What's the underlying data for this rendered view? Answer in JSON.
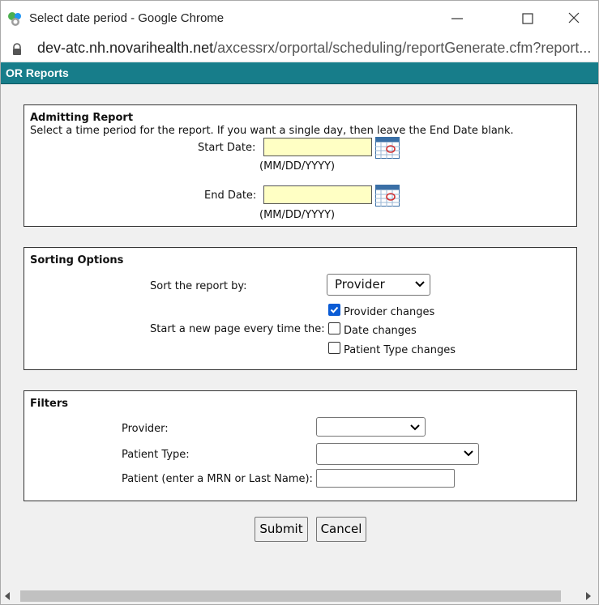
{
  "window": {
    "title": "Select date period - Google Chrome"
  },
  "browser": {
    "url_host": "dev-atc.nh.novarihealth.net",
    "url_path": "/axcessrx/orportal/scheduling/reportGenerate.cfm?report..."
  },
  "header": {
    "title": "OR Reports"
  },
  "admitting": {
    "title": "Admitting Report",
    "instructions": "Select a time period for the report. If you want a single day, then leave the End Date blank.",
    "start_label": "Start Date:",
    "start_value": "",
    "end_label": "End Date:",
    "end_value": "",
    "format_hint": "(MM/DD/YYYY)"
  },
  "sorting": {
    "title": "Sorting Options",
    "sort_label": "Sort the report by:",
    "sort_value": "Provider",
    "newpage_label": "Start a new page every time the:",
    "options": [
      {
        "label": "Provider changes",
        "checked": true
      },
      {
        "label": "Date changes",
        "checked": false
      },
      {
        "label": "Patient Type changes",
        "checked": false
      }
    ]
  },
  "filters": {
    "title": "Filters",
    "provider_label": "Provider:",
    "provider_value": "",
    "patient_type_label": "Patient Type:",
    "patient_type_value": "",
    "patient_label": "Patient (enter a MRN or Last Name):",
    "patient_value": ""
  },
  "actions": {
    "submit": "Submit",
    "cancel": "Cancel"
  },
  "colors": {
    "header_bg": "#177d8a",
    "date_input_bg": "#ffffc4",
    "checkbox_accent": "#0b5cd5"
  },
  "icons": [
    "chrome-app-icon",
    "minimize-icon",
    "maximize-icon",
    "close-icon",
    "lock-icon",
    "calendar-icon",
    "chevron-down-icon",
    "checkmark-icon",
    "scroll-left-icon",
    "scroll-right-icon"
  ]
}
